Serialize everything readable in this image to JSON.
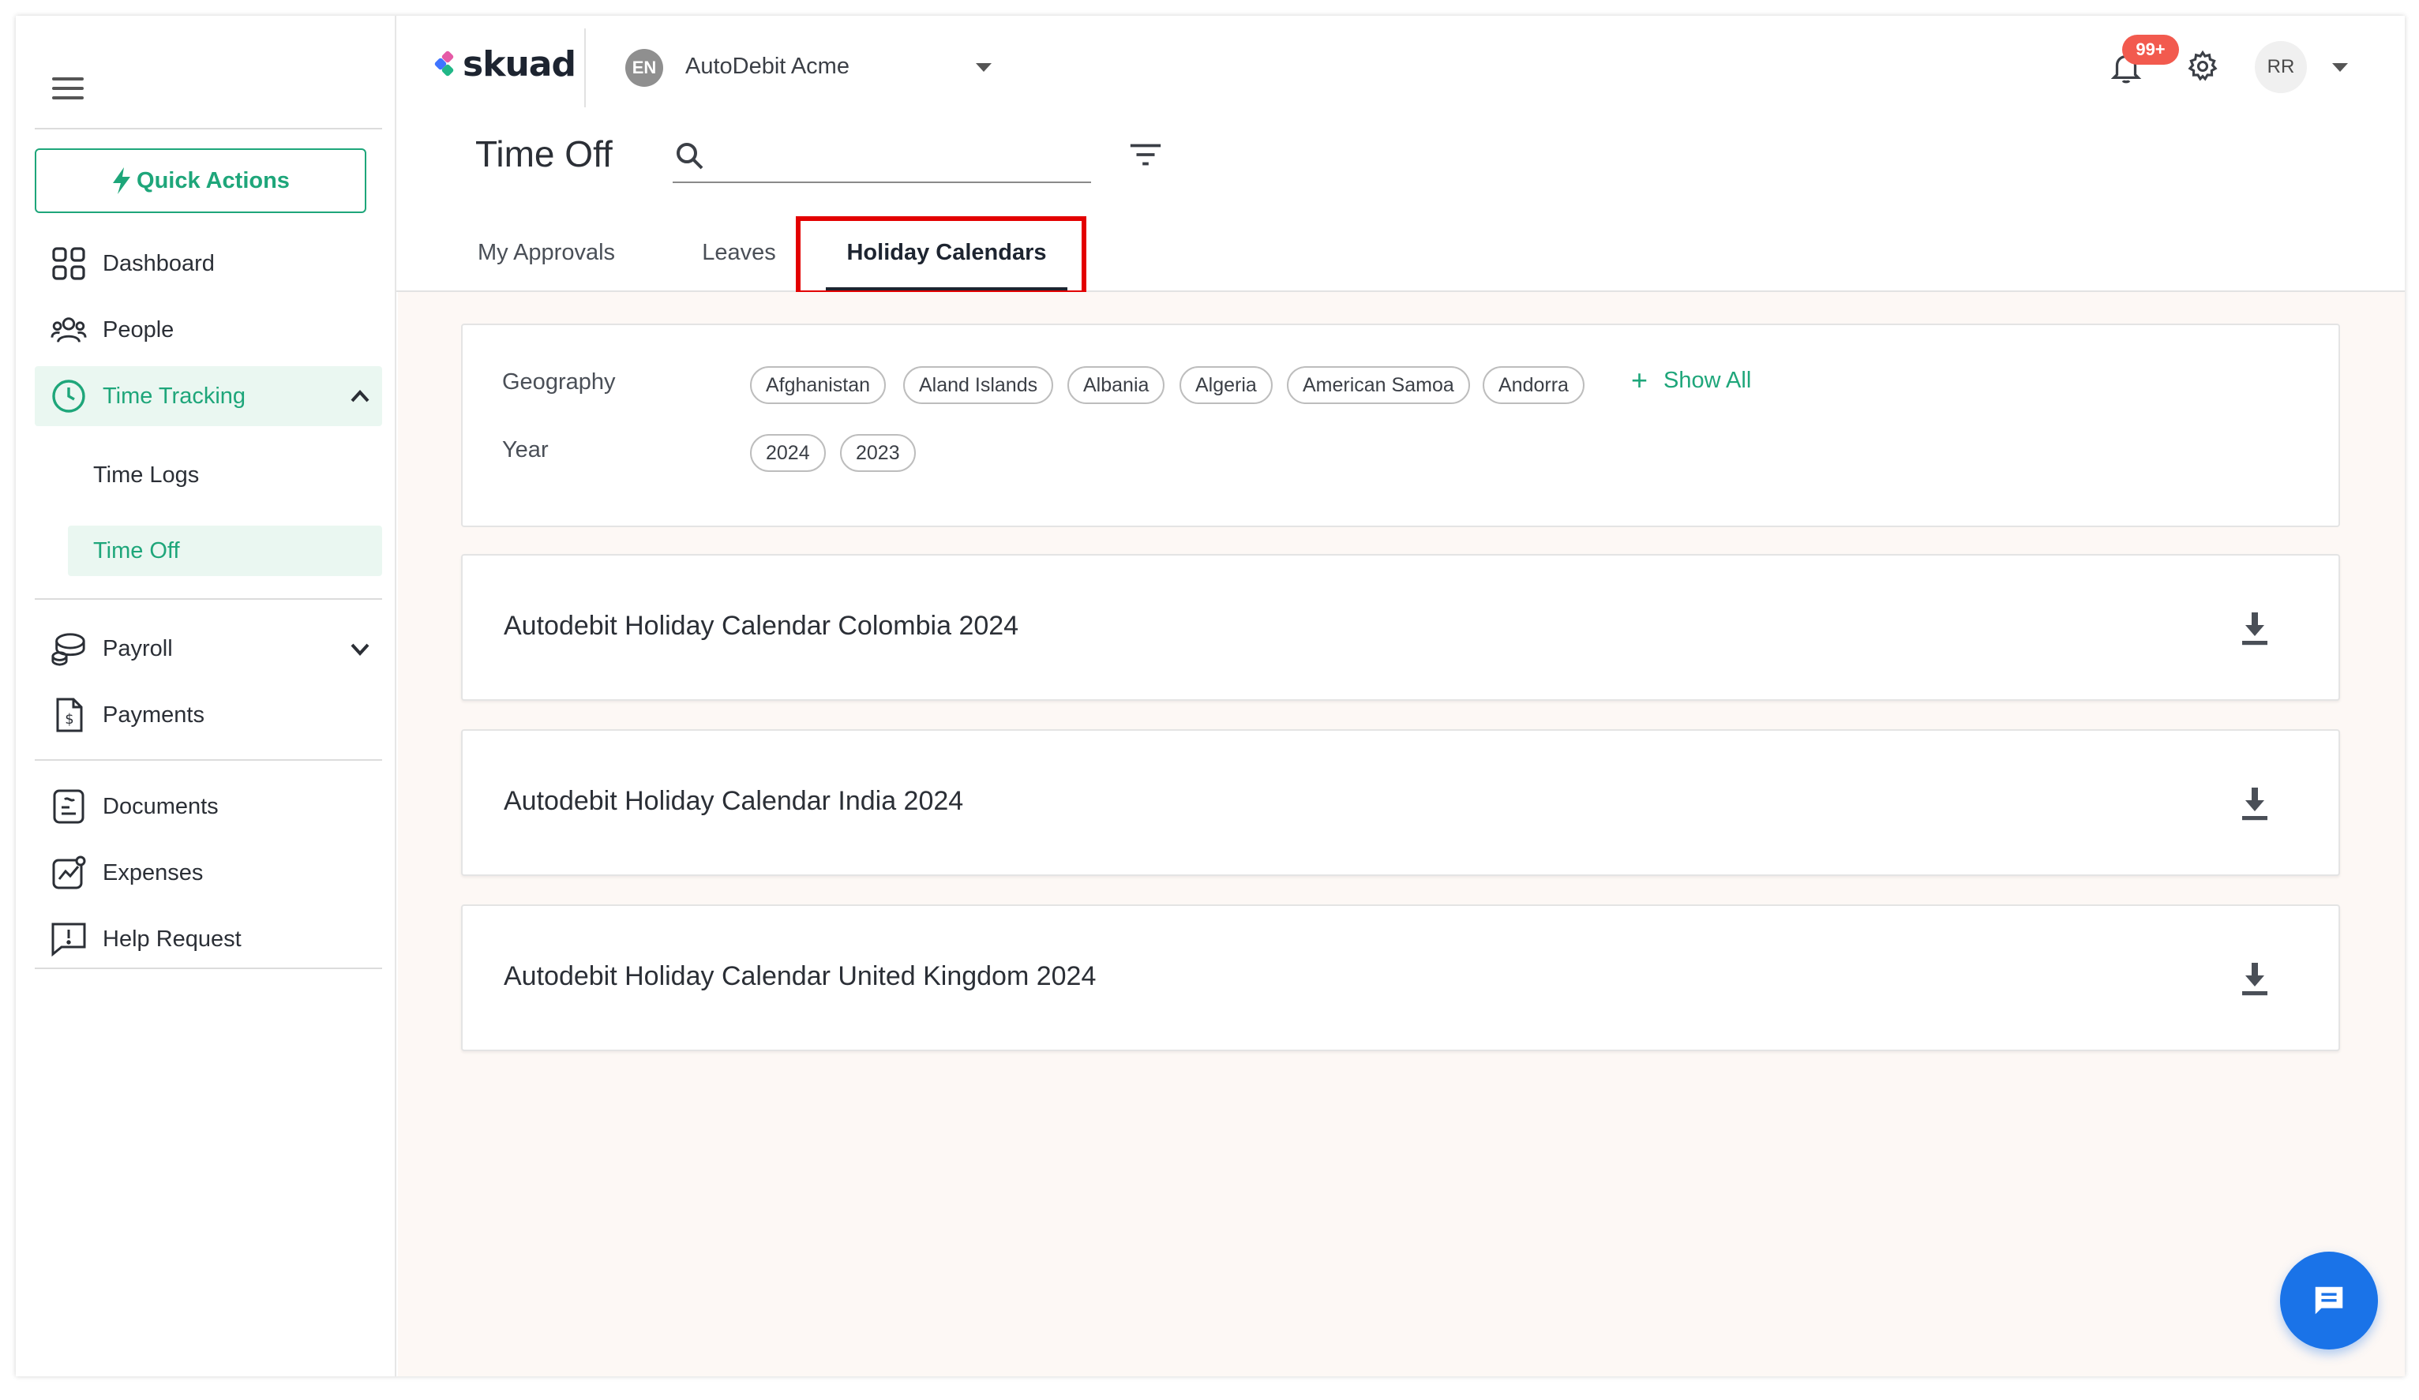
{
  "sidebar": {
    "quick_actions": "Quick Actions",
    "items": {
      "dashboard": "Dashboard",
      "people": "People",
      "time_tracking": "Time Tracking",
      "time_logs": "Time Logs",
      "time_off": "Time Off",
      "payroll": "Payroll",
      "payments": "Payments",
      "documents": "Documents",
      "expenses": "Expenses",
      "help_request": "Help Request"
    }
  },
  "header": {
    "logo_text": "skuad",
    "org_badge": "EN",
    "org_name": "AutoDebit Acme",
    "notification_count": "99+",
    "user_initials": "RR"
  },
  "page": {
    "title": "Time Off",
    "search": {
      "value": "",
      "placeholder": ""
    }
  },
  "tabs": [
    {
      "label": "My Approvals",
      "active": false
    },
    {
      "label": "Leaves",
      "active": false
    },
    {
      "label": "Holiday Calendars",
      "active": true
    }
  ],
  "filters": {
    "geography_label": "Geography",
    "geography_options": [
      "Afghanistan",
      "Aland Islands",
      "Albania",
      "Algeria",
      "American Samoa",
      "Andorra"
    ],
    "show_all": "Show All",
    "year_label": "Year",
    "year_options": [
      "2024",
      "2023"
    ]
  },
  "calendars": [
    {
      "title": "Autodebit Holiday Calendar Colombia 2024"
    },
    {
      "title": "Autodebit Holiday Calendar India 2024"
    },
    {
      "title": "Autodebit Holiday Calendar United Kingdom 2024"
    }
  ],
  "colors": {
    "accent": "#1ea67a",
    "active_bg": "#eaf7f1",
    "notification": "#f25a4e",
    "highlight_box": "#e30000",
    "chat_button": "#1a73e8",
    "content_bg": "#fdf8f5"
  },
  "icons": {
    "menu": "hamburger-icon",
    "quick_actions": "lightning-icon",
    "dashboard": "grid-icon",
    "people": "people-icon",
    "time_tracking": "clock-icon",
    "payroll": "coins-icon",
    "payments": "dollar-document-icon",
    "documents": "document-icon",
    "expenses": "chart-icon",
    "help": "alert-message-icon",
    "notifications": "bell-icon",
    "settings": "gear-icon",
    "search": "search-icon",
    "filter": "filter-icon",
    "download": "download-icon",
    "chat": "chat-icon"
  }
}
